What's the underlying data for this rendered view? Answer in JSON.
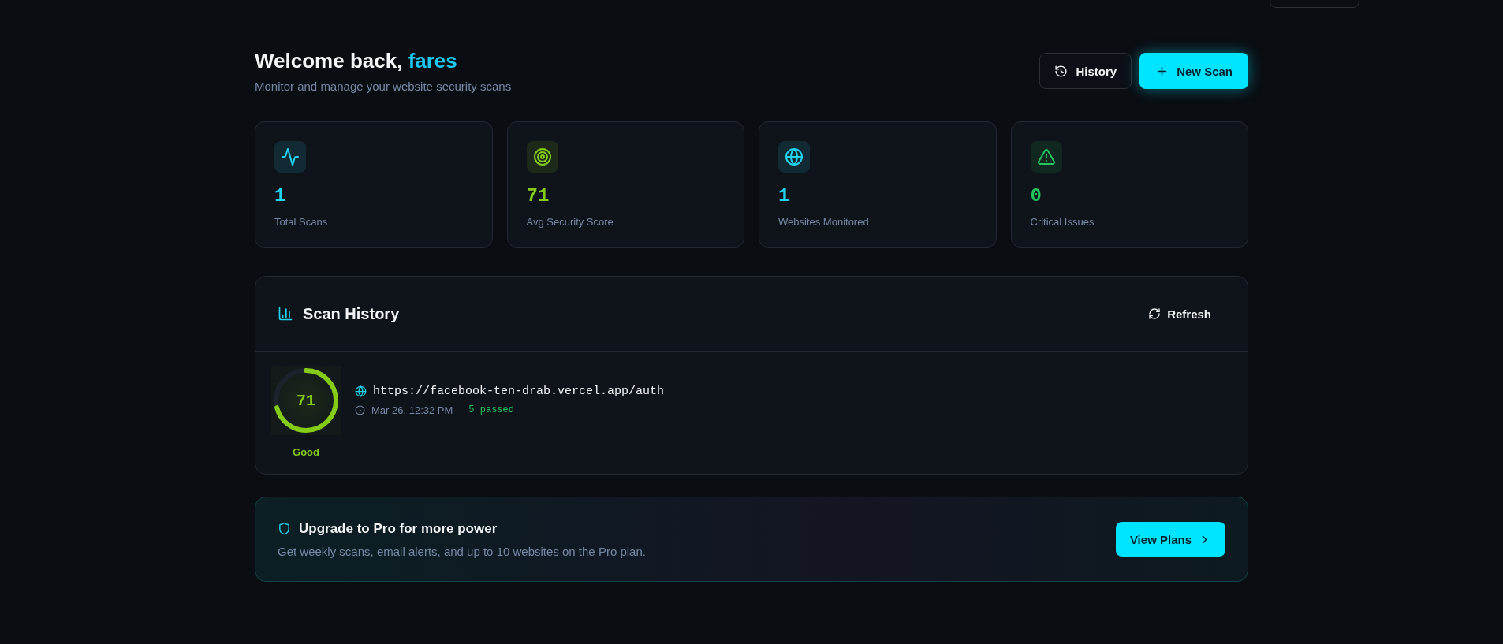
{
  "header": {
    "greeting": "Welcome back,",
    "username": "fares",
    "subtitle": "Monitor and manage your website security scans"
  },
  "actions": [
    {
      "label": "History",
      "kind": "outline"
    },
    {
      "label": "New Scan",
      "kind": "primary"
    }
  ],
  "stats": [
    {
      "kind": "activity",
      "value": "1",
      "label": "Total Scans",
      "color": "#22d3ee"
    },
    {
      "kind": "target",
      "value": "71",
      "label": "Avg Security Score",
      "color": "#84cc16"
    },
    {
      "kind": "globe",
      "value": "1",
      "label": "Websites Monitored",
      "color": "#22d3ee"
    },
    {
      "kind": "alert",
      "value": "0",
      "label": "Critical Issues",
      "color": "#22c55e"
    }
  ],
  "scan_history": {
    "title": "Scan History",
    "refresh": "Refresh",
    "scans": [
      {
        "score": "71",
        "level": 0.71,
        "rating": "Good",
        "url": "https://facebook-ten-drab.vercel.app/auth",
        "date": "Mar 26, 12:32 PM",
        "passed": "5 passed"
      }
    ]
  },
  "upgrade": {
    "title": "Upgrade to Pro for more power",
    "text": "Get weekly scans, email alerts, and up to 10 websites on the Pro plan.",
    "button": "View Plans"
  }
}
